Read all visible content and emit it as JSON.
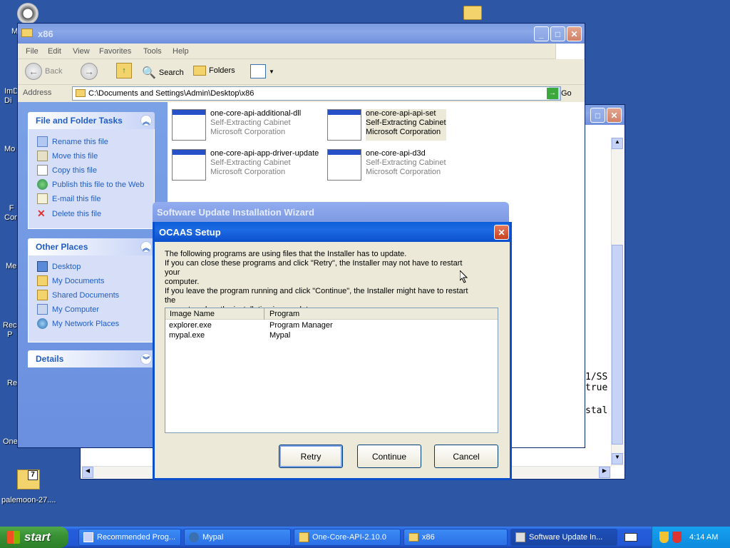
{
  "desktop": {
    "icons": [
      {
        "label": "M",
        "name": "desktop-icon-m"
      },
      {
        "label": "ImD\nDi",
        "name": "desktop-icon-imd"
      },
      {
        "label": "Mo",
        "name": "desktop-icon-mo"
      },
      {
        "label": "F\nCon",
        "name": "desktop-icon-f"
      },
      {
        "label": "Me",
        "name": "desktop-icon-me"
      },
      {
        "label": "Rec\nP",
        "name": "desktop-icon-rec"
      },
      {
        "label": "Re",
        "name": "desktop-icon-re"
      },
      {
        "label": "One",
        "name": "desktop-icon-one"
      },
      {
        "label": "palemoon-27....",
        "name": "desktop-icon-palemoon"
      }
    ]
  },
  "explorer": {
    "title": "x86",
    "menu": [
      "File",
      "Edit",
      "View",
      "Favorites",
      "Tools",
      "Help"
    ],
    "toolbar": {
      "back": "Back",
      "search": "Search",
      "folders": "Folders"
    },
    "address_label": "Address",
    "address_value": "C:\\Documents and Settings\\Admin\\Desktop\\x86",
    "go_label": "Go",
    "tasks_title": "File and Folder Tasks",
    "tasks": [
      "Rename this file",
      "Move this file",
      "Copy this file",
      "Publish this file to the Web",
      "E-mail this file",
      "Delete this file"
    ],
    "places_title": "Other Places",
    "places": [
      "Desktop",
      "My Documents",
      "Shared Documents",
      "My Computer",
      "My Network Places"
    ],
    "details_title": "Details",
    "files": [
      {
        "name": "one-core-api-additional-dll",
        "type": "Self-Extracting Cabinet",
        "company": "Microsoft Corporation"
      },
      {
        "name": "one-core-api-api-set",
        "type": "Self-Extracting Cabinet",
        "company": "Microsoft Corporation"
      },
      {
        "name": "one-core-api-app-driver-update",
        "type": "Self-Extracting Cabinet",
        "company": "Microsoft Corporation"
      },
      {
        "name": "one-core-api-d3d",
        "type": "Self-Extracting Cabinet",
        "company": "Microsoft Corporation"
      }
    ]
  },
  "background_window": {
    "text_lines": [
      "1/SS",
      "true",
      "stal"
    ]
  },
  "wizard": {
    "title": "Software Update Installation Wizard"
  },
  "dialog": {
    "title": "OCAAS Setup",
    "message": [
      "The following programs are using files that the Installer has to update.",
      "If you can close these programs and click \"Retry\", the Installer may not have to restart your",
      "computer.",
      "If you leave the program running and click \"Continue\", the Installer might have to restart the",
      "computer when the installation is complete."
    ],
    "columns": [
      "Image Name",
      "Program"
    ],
    "rows": [
      {
        "image": "explorer.exe",
        "program": "Program Manager"
      },
      {
        "image": "mypal.exe",
        "program": "Mypal"
      }
    ],
    "buttons": {
      "retry": "Retry",
      "continue": "Continue",
      "cancel": "Cancel"
    }
  },
  "taskbar": {
    "start": "start",
    "items": [
      "Recommended Prog...",
      "Mypal",
      "One-Core-API-2.10.0",
      "x86",
      "Software Update In..."
    ],
    "clock": "4:14 AM"
  }
}
